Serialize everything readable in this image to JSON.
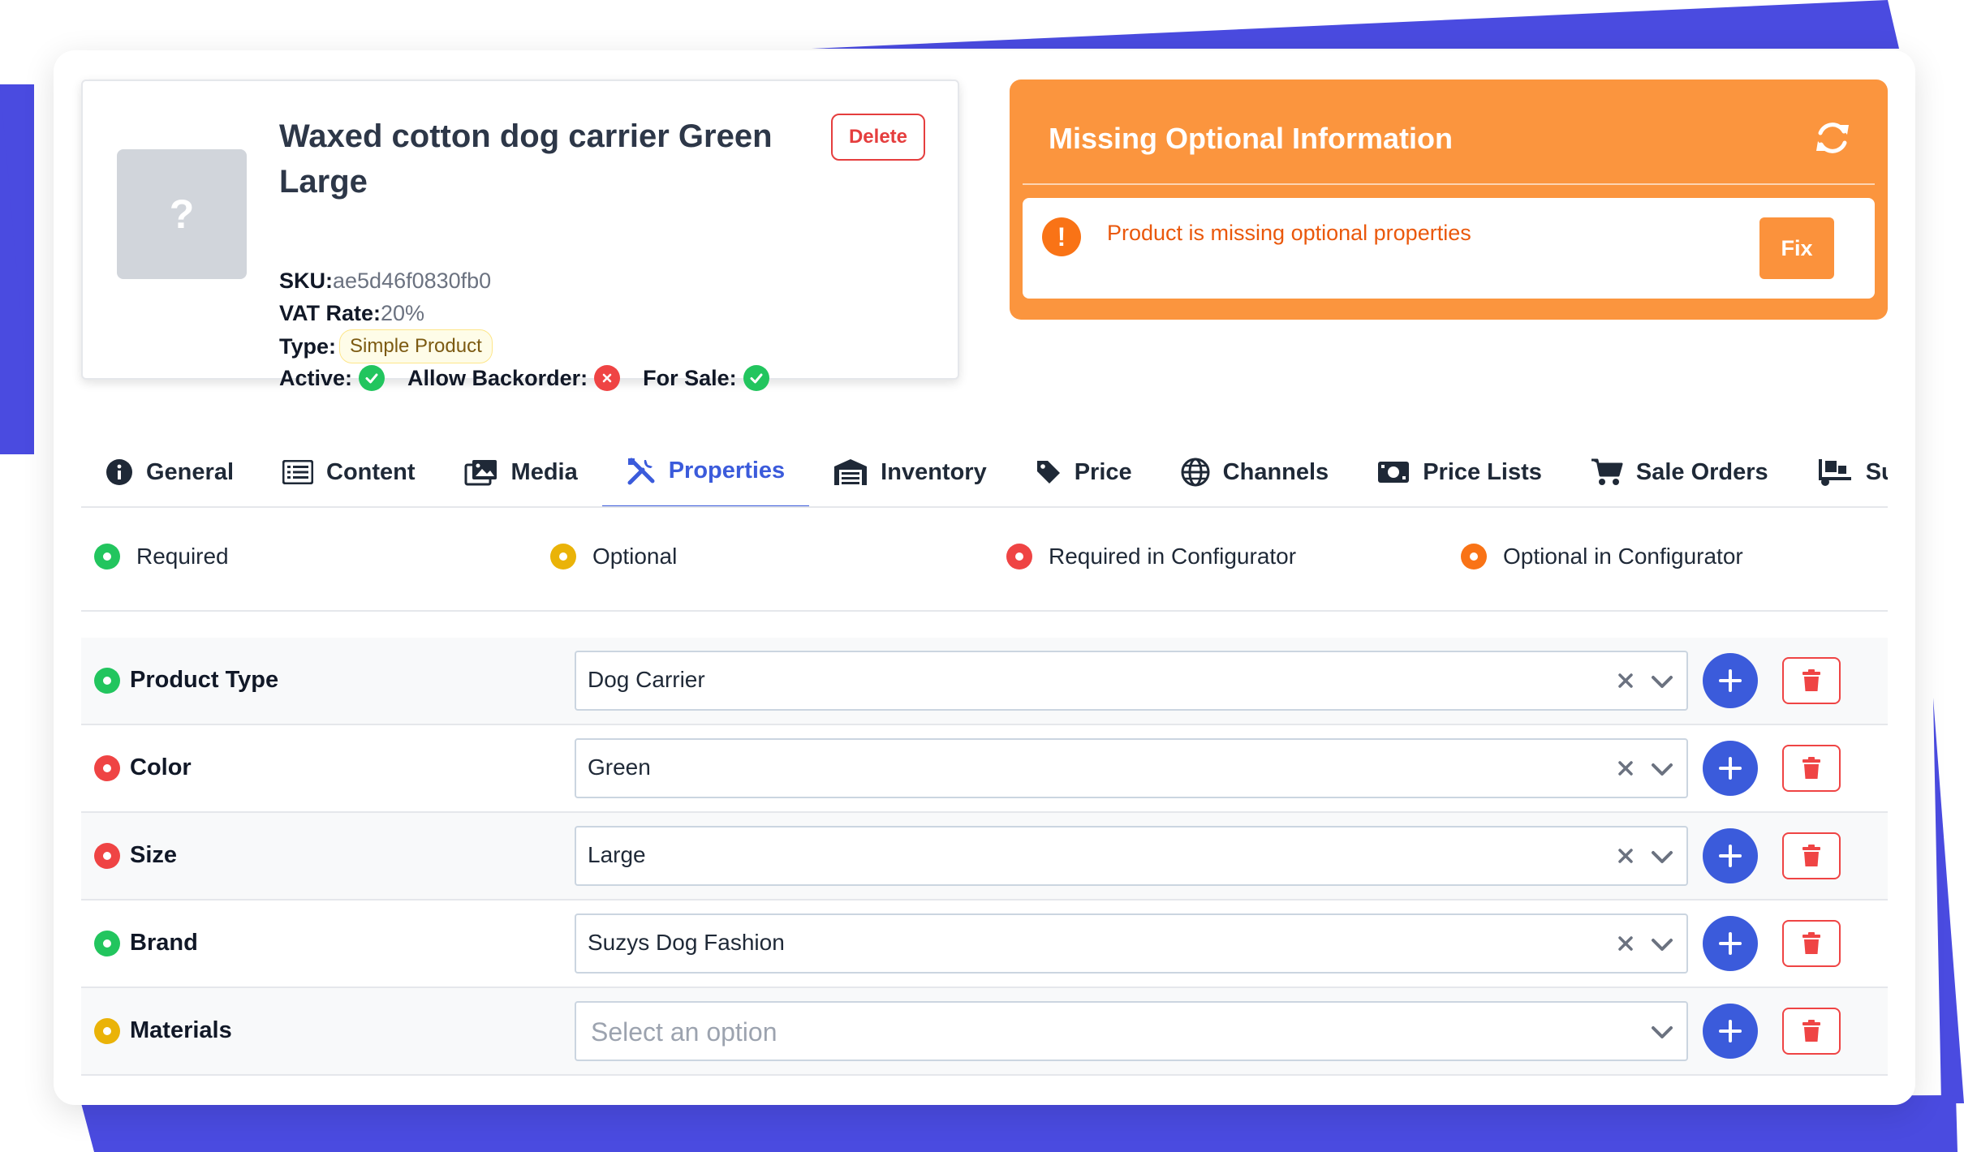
{
  "colors": {
    "accent": "#3b5bdb",
    "frame": "#4a4be0",
    "warning": "#fb953e",
    "required": "#22c55e",
    "optional": "#eab308",
    "required_configurator": "#ef4444",
    "optional_configurator": "#f97316"
  },
  "product": {
    "image_placeholder": "?",
    "title": "Waxed cotton dog carrier Green Large",
    "delete_label": "Delete",
    "sku_label": "SKU:",
    "sku": "ae5d46f0830fb0",
    "vat_label": "VAT Rate:",
    "vat": "20%",
    "type_label": "Type:",
    "type": "Simple Product",
    "active_label": "Active:",
    "backorder_label": "Allow Backorder:",
    "for_sale_label": "For Sale:"
  },
  "missing": {
    "title": "Missing Optional Information",
    "alert_symbol": "!",
    "message": "Product is missing optional properties",
    "fix_label": "Fix"
  },
  "tabs": [
    {
      "label": "General",
      "icon": "info-circle-icon"
    },
    {
      "label": "Content",
      "icon": "list-icon"
    },
    {
      "label": "Media",
      "icon": "images-icon"
    },
    {
      "label": "Properties",
      "icon": "tools-icon",
      "active": true
    },
    {
      "label": "Inventory",
      "icon": "warehouse-icon"
    },
    {
      "label": "Price",
      "icon": "tag-icon"
    },
    {
      "label": "Channels",
      "icon": "globe-icon"
    },
    {
      "label": "Price Lists",
      "icon": "money-bill-icon"
    },
    {
      "label": "Sale Orders",
      "icon": "shopping-cart-icon"
    },
    {
      "label": "Su",
      "icon": "truck-loading-icon"
    }
  ],
  "legend": [
    {
      "label": "Required",
      "color": "#22c55e"
    },
    {
      "label": "Optional",
      "color": "#eab308"
    },
    {
      "label": "Required in Configurator",
      "color": "#ef4444"
    },
    {
      "label": "Optional in Configurator",
      "color": "#f97316"
    }
  ],
  "properties": [
    {
      "label": "Product Type",
      "value": "Dog Carrier",
      "color": "#22c55e"
    },
    {
      "label": "Color",
      "value": "Green",
      "color": "#ef4444"
    },
    {
      "label": "Size",
      "value": "Large",
      "color": "#ef4444"
    },
    {
      "label": "Brand",
      "value": "Suzys Dog Fashion",
      "color": "#22c55e"
    },
    {
      "label": "Materials",
      "value": "",
      "placeholder": "Select an option",
      "color": "#eab308"
    }
  ]
}
